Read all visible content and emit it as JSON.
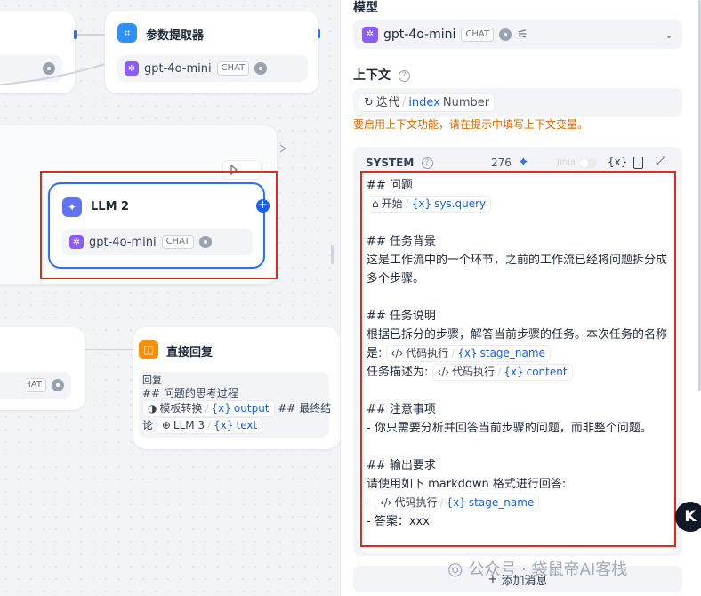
{
  "canvas": {
    "param_extractor": {
      "title": "参数提取器",
      "model": "gpt-4o-mini",
      "tag": "CHAT"
    },
    "llm2": {
      "title": "LLM 2",
      "model": "gpt-4o-mini",
      "tag": "CHAT"
    },
    "answer": {
      "title": "直接回复",
      "label": "回复",
      "line1": "## 问题的思考过程",
      "var1_node": "模板转换",
      "var1_name": "output",
      "mid_text": "## 最终结",
      "line3_prefix": "论",
      "var2_node": "LLM 3",
      "var2_name": "text"
    },
    "left_tag": "CHAT"
  },
  "panel": {
    "model_label": "模型",
    "model_name": "gpt-4o-mini",
    "model_tag": "CHAT",
    "context_label": "上下文",
    "context_var_node": "迭代",
    "context_var_name": "index",
    "context_var_type": "Number",
    "context_warning": "要启用上下文功能，请在提示中填写上下文变量。",
    "system_label": "SYSTEM",
    "token_count": "276",
    "jinja_label": "Jinja",
    "var_button": "{x}",
    "add_message": "添加消息",
    "watermark": "公众号 · 袋鼠帝AI客栈",
    "prompt": {
      "h1": "## 问题",
      "q_node": "开始",
      "q_var": "sys.query",
      "h2": "## 任务背景",
      "bg1": "这是工作流中的一个环节，之前的工作流已经将问题拆分成",
      "bg2": "多个步骤。",
      "h3": "## 任务说明",
      "desc1": "根据已拆分的步骤，解答当前步骤的任务。本次任务的名称",
      "desc2_prefix": "是:",
      "code_node": "代码执行",
      "stage_var": "stage_name",
      "desc3_prefix": "任务描述为:",
      "content_var": "content",
      "h4": "## 注意事项",
      "note1": "- 你只需要分析并回答当前步骤的问题，而非整个问题。",
      "h5": "## 输出要求",
      "out1": "请使用如下 markdown 格式进行回答:",
      "out2_prefix": "-",
      "out3": "- 答案：xxx"
    }
  }
}
